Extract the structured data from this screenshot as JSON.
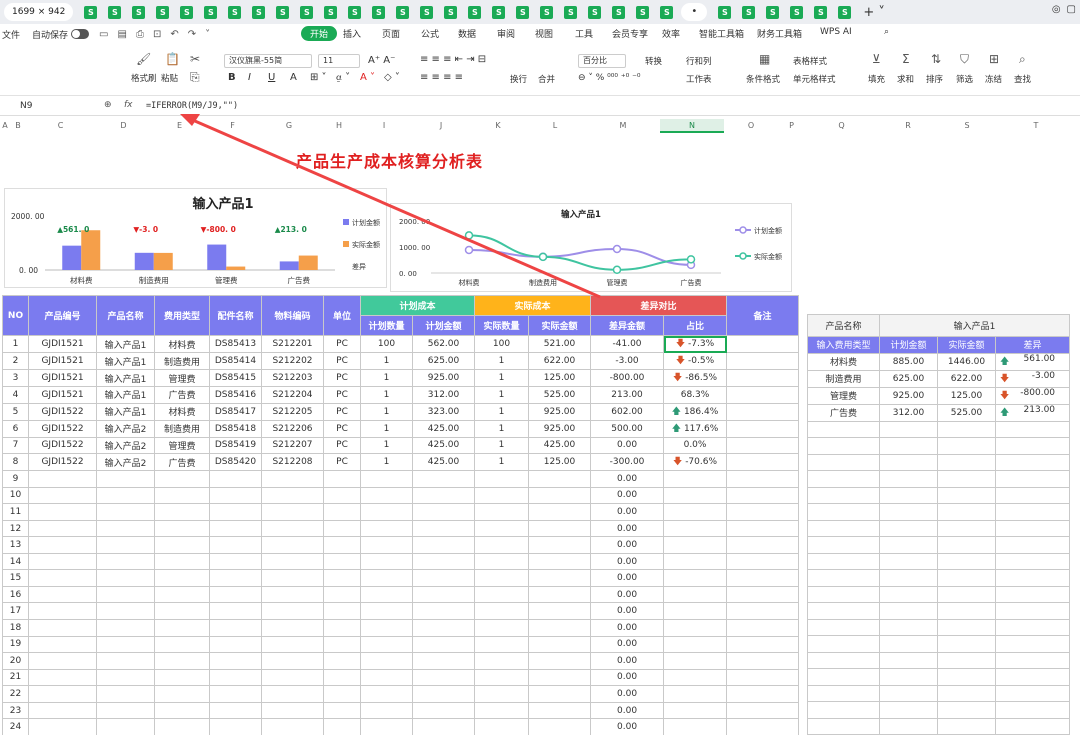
{
  "window": {
    "size_label": "1699 × 942",
    "sheet_icon": "S",
    "active_tab_mark": "•",
    "plus": "+ ˅",
    "colors": {
      "brand": "#1aaa55",
      "header": "#7b7bef",
      "plan": "#41c99b",
      "actual": "#ffb31a",
      "diff": "#e55656",
      "title": "#e02020"
    }
  },
  "menu": {
    "file": "文件",
    "autosave": "自动保存",
    "items": [
      "开始",
      "插入",
      "页面",
      "公式",
      "数据",
      "审阅",
      "视图",
      "工具",
      "会员专享",
      "效率",
      "智能工具箱",
      "财务工具箱",
      "WPS AI"
    ],
    "active": "开始"
  },
  "ribbon": {
    "format_painter": "格式刷",
    "paste": "粘贴",
    "font_name": "汉仪旗黑-55简",
    "font_size": "11",
    "number_format": "百分比",
    "convert": "转换",
    "row_col": "行和列",
    "worksheet": "工作表",
    "table_style": "表格样式",
    "cell_style": "单元格样式",
    "cond_format": "条件格式",
    "wrap": "换行",
    "merge": "合并",
    "fill": "填充",
    "sum": "求和",
    "sort": "排序",
    "filter": "筛选",
    "freeze": "冻结",
    "find": "查找"
  },
  "formula_bar": {
    "name_box": "N9",
    "fx": "fx",
    "formula": "=IFERROR(M9/J9,\"\")"
  },
  "columns": [
    "A",
    "B",
    "C",
    "D",
    "E",
    "F",
    "G",
    "H",
    "I",
    "J",
    "K",
    "L",
    "M",
    "N",
    "O",
    "P",
    "Q",
    "R",
    "S",
    "T"
  ],
  "selected_column": "N",
  "title": "产品生产成本核算分析表",
  "bar_chart": {
    "title": "输入产品1",
    "ymax_label": "2000. 00",
    "ymin_label": "0. 00",
    "legend": [
      "计划金额",
      "实际金额",
      "差异"
    ]
  },
  "line_chart": {
    "title": "输入产品1",
    "tick_labels": [
      "2000. 00",
      "1000. 00",
      "0. 00"
    ],
    "legend": [
      "计划金额",
      "实际金额"
    ]
  },
  "chart_data": [
    {
      "type": "bar",
      "title": "输入产品1",
      "categories": [
        "材料费",
        "制造费用",
        "管理费",
        "广告费"
      ],
      "series": [
        {
          "name": "计划金额",
          "values": [
            885,
            625,
            925,
            312
          ]
        },
        {
          "name": "实际金额",
          "values": [
            1446,
            622,
            125,
            525
          ]
        }
      ],
      "annotations": [
        "▲561. 0",
        "▼-3. 0",
        "▼-800. 0",
        "▲213. 0"
      ],
      "ylim": [
        0,
        2000
      ]
    },
    {
      "type": "line",
      "title": "输入产品1",
      "categories": [
        "材料费",
        "制造费用",
        "管理费",
        "广告费"
      ],
      "series": [
        {
          "name": "计划金额",
          "values": [
            885,
            625,
            925,
            312
          ]
        },
        {
          "name": "实际金额",
          "values": [
            1446,
            622,
            125,
            525
          ]
        }
      ],
      "ylim": [
        0,
        2000
      ]
    }
  ],
  "table": {
    "headers": {
      "no": "NO",
      "code": "产品编号",
      "name": "产品名称",
      "type": "费用类型",
      "part": "配件名称",
      "material": "物料编码",
      "unit": "单位",
      "plan": "计划成本",
      "actual": "实际成本",
      "diff": "差异对比",
      "note": "备注",
      "plan_qty": "计划数量",
      "plan_amt": "计划金额",
      "act_qty": "实际数量",
      "act_amt": "实际金额",
      "diff_amt": "差异金额",
      "ratio": "占比"
    },
    "rows": [
      {
        "no": "1",
        "code": "GJDI1521",
        "name": "输入产品1",
        "type": "材料费",
        "part": "DS85413",
        "material": "S212201",
        "unit": "PC",
        "plan_qty": "100",
        "plan_amt": "562.00",
        "act_qty": "100",
        "act_amt": "521.00",
        "diff_amt": "-41.00",
        "dir": "down",
        "ratio": "-7.3%"
      },
      {
        "no": "2",
        "code": "GJDI1521",
        "name": "输入产品1",
        "type": "制造费用",
        "part": "DS85414",
        "material": "S212202",
        "unit": "PC",
        "plan_qty": "1",
        "plan_amt": "625.00",
        "act_qty": "1",
        "act_amt": "622.00",
        "diff_amt": "-3.00",
        "dir": "down",
        "ratio": "-0.5%"
      },
      {
        "no": "3",
        "code": "GJDI1521",
        "name": "输入产品1",
        "type": "管理费",
        "part": "DS85415",
        "material": "S212203",
        "unit": "PC",
        "plan_qty": "1",
        "plan_amt": "925.00",
        "act_qty": "1",
        "act_amt": "125.00",
        "diff_amt": "-800.00",
        "dir": "down",
        "ratio": "-86.5%"
      },
      {
        "no": "4",
        "code": "GJDI1521",
        "name": "输入产品1",
        "type": "广告费",
        "part": "DS85416",
        "material": "S212204",
        "unit": "PC",
        "plan_qty": "1",
        "plan_amt": "312.00",
        "act_qty": "1",
        "act_amt": "525.00",
        "diff_amt": "213.00",
        "dir": "",
        "ratio": "68.3%"
      },
      {
        "no": "5",
        "code": "GJDI1522",
        "name": "输入产品1",
        "type": "材料费",
        "part": "DS85417",
        "material": "S212205",
        "unit": "PC",
        "plan_qty": "1",
        "plan_amt": "323.00",
        "act_qty": "1",
        "act_amt": "925.00",
        "diff_amt": "602.00",
        "dir": "up",
        "ratio": "186.4%"
      },
      {
        "no": "6",
        "code": "GJDI1522",
        "name": "输入产品2",
        "type": "制造费用",
        "part": "DS85418",
        "material": "S212206",
        "unit": "PC",
        "plan_qty": "1",
        "plan_amt": "425.00",
        "act_qty": "1",
        "act_amt": "925.00",
        "diff_amt": "500.00",
        "dir": "up",
        "ratio": "117.6%"
      },
      {
        "no": "7",
        "code": "GJDI1522",
        "name": "输入产品2",
        "type": "管理费",
        "part": "DS85419",
        "material": "S212207",
        "unit": "PC",
        "plan_qty": "1",
        "plan_amt": "425.00",
        "act_qty": "1",
        "act_amt": "425.00",
        "diff_amt": "0.00",
        "dir": "",
        "ratio": "0.0%"
      },
      {
        "no": "8",
        "code": "GJDI1522",
        "name": "输入产品2",
        "type": "广告费",
        "part": "DS85420",
        "material": "S212208",
        "unit": "PC",
        "plan_qty": "1",
        "plan_amt": "425.00",
        "act_qty": "1",
        "act_amt": "125.00",
        "diff_amt": "-300.00",
        "dir": "down",
        "ratio": "-70.6%"
      }
    ],
    "empty_rows": [
      "9",
      "10",
      "11",
      "12",
      "13",
      "14",
      "15",
      "16",
      "17",
      "18",
      "19",
      "20",
      "21",
      "22",
      "23",
      "24"
    ],
    "empty_diff": "0.00"
  },
  "side_table": {
    "product_label": "产品名称",
    "product_value": "输入产品1",
    "headers": [
      "输入费用类型",
      "计划金额",
      "实际金额",
      "差异"
    ],
    "rows": [
      {
        "type": "材料费",
        "plan": "885.00",
        "actual": "1446.00",
        "dir": "up",
        "diff": "561.00"
      },
      {
        "type": "制造费用",
        "plan": "625.00",
        "actual": "622.00",
        "dir": "down",
        "diff": "-3.00"
      },
      {
        "type": "管理费",
        "plan": "925.00",
        "actual": "125.00",
        "dir": "down",
        "diff": "-800.00"
      },
      {
        "type": "广告费",
        "plan": "312.00",
        "actual": "525.00",
        "dir": "up",
        "diff": "213.00"
      }
    ]
  }
}
